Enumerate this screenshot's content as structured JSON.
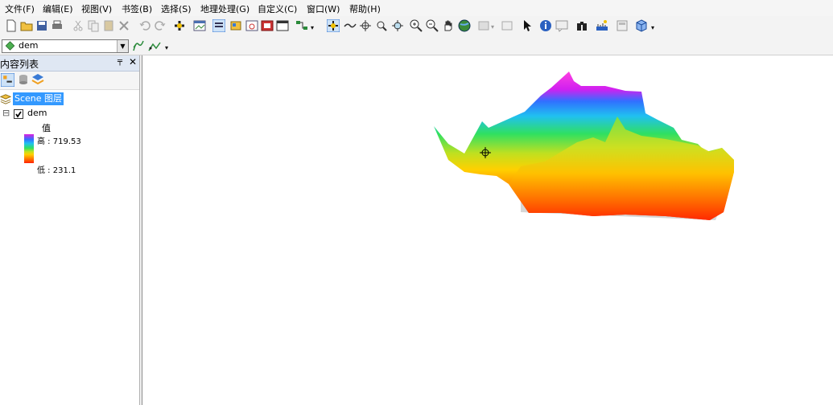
{
  "menu": [
    "文件(F)",
    "编辑(E)",
    "视图(V)",
    "书签(B)",
    "选择(S)",
    "地理处理(G)",
    "自定义(C)",
    "窗口(W)",
    "帮助(H)"
  ],
  "toolbar": {
    "icons": [
      "new-icon",
      "open-icon",
      "save-icon",
      "print-icon",
      "cut-icon",
      "copy-icon",
      "paste-icon",
      "delete-icon",
      "undo-icon",
      "redo-icon",
      "add-data-icon",
      "window-icon",
      "toc-icon",
      "catalog-icon",
      "search-window-icon",
      "results-icon",
      "layout-icon",
      "flow-icon",
      "navigate-icon",
      "fly-icon",
      "center-target-icon",
      "zoom-target-icon",
      "target-observer-icon",
      "zoom-in-icon",
      "zoom-out-icon",
      "pan-icon",
      "full-extent-icon",
      "layer-view-icon",
      "select-arrow-icon",
      "identify-icon",
      "html-popup-icon",
      "find-icon",
      "measure-icon",
      "layer-icon",
      "scene-properties-icon"
    ]
  },
  "layer_select": {
    "value": "dem"
  },
  "toc": {
    "title": "内容列表",
    "pin": "╤",
    "close": "✕",
    "scene_label": "Scene 图层",
    "layer": {
      "name": "dem",
      "checked": true,
      "expand": "⊟"
    },
    "legend": {
      "field": "值",
      "high": "高 : 719.53",
      "low": "低 : 231.1"
    }
  },
  "colors": {
    "ramp": [
      "#e020e0",
      "#3070ff",
      "#20c0f0",
      "#30e060",
      "#c0e020",
      "#ffd000",
      "#ff8000",
      "#ff2000"
    ],
    "selection": "#3399ff",
    "toc_header": "#dfe7f3"
  }
}
